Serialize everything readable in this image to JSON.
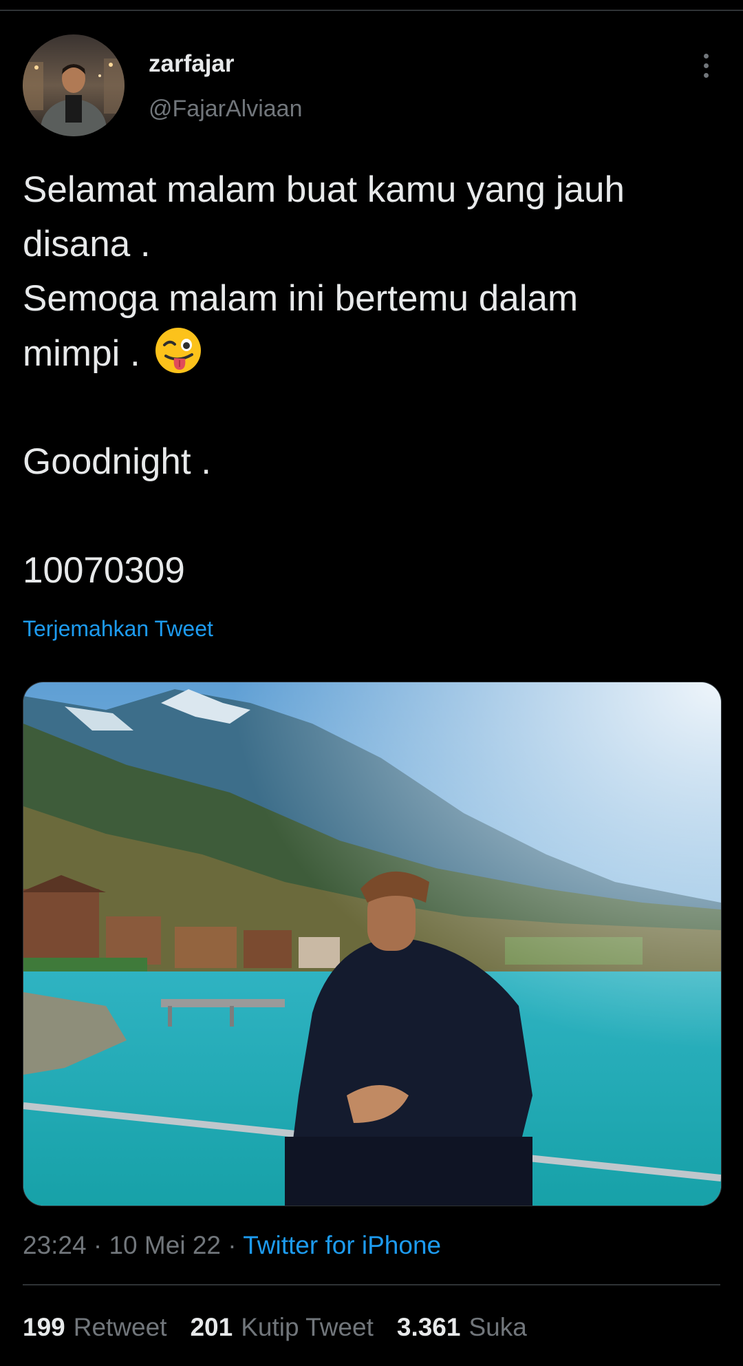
{
  "colors": {
    "background": "#000000",
    "text_primary": "#e7e9ea",
    "text_secondary": "#71767b",
    "link": "#1d9bf0",
    "divider": "#2f3336"
  },
  "author": {
    "display_name": "zarfajar",
    "handle": "@FajarAlviaan",
    "avatar_icon": "user-avatar-photo"
  },
  "more_menu_icon": "vertical-ellipsis-icon",
  "tweet": {
    "lines": [
      "Selamat malam buat kamu yang jauh",
      "disana .",
      "Semoga malam ini bertemu dalam",
      "mimpi . ",
      "Goodnight .",
      "10070309"
    ],
    "emoji": "😜",
    "emoji_icon": "winking-face-with-tongue-emoji",
    "translate_label": "Terjemahkan Tweet"
  },
  "media": {
    "icon": "photo-man-by-lake-with-mountains"
  },
  "meta": {
    "time": "23:24",
    "separator": " · ",
    "date": "10 Mei 22",
    "source": "Twitter for iPhone"
  },
  "stats": {
    "retweets": {
      "count": "199",
      "label": "Retweet"
    },
    "quotes": {
      "count": "201",
      "label": "Kutip Tweet"
    },
    "likes": {
      "count": "3.361",
      "label": "Suka"
    }
  }
}
